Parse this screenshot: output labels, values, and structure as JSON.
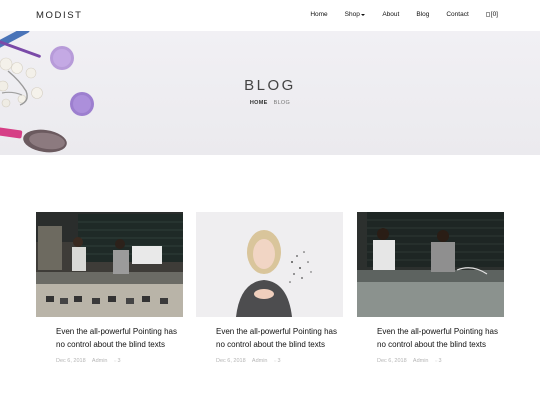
{
  "nav": {
    "brand": "MODIST",
    "items": [
      {
        "label": "Home"
      },
      {
        "label": "Shop"
      },
      {
        "label": "About"
      },
      {
        "label": "Blog"
      },
      {
        "label": "Contact"
      }
    ],
    "cart_count": "[0]"
  },
  "hero": {
    "title": "BLOG",
    "breadcrumb_home": "HOME",
    "breadcrumb_current": "BLOG"
  },
  "posts": [
    {
      "title": "Even the all-powerful Pointing has no control about the blind texts",
      "date": "Dec 6, 2018",
      "author": "Admin",
      "comments": "3"
    },
    {
      "title": "Even the all-powerful Pointing has no control about the blind texts",
      "date": "Dec 6, 2018",
      "author": "Admin",
      "comments": "3"
    },
    {
      "title": "Even the all-powerful Pointing has no control about the blind texts",
      "date": "Dec 6, 2018",
      "author": "Admin",
      "comments": "3"
    }
  ]
}
